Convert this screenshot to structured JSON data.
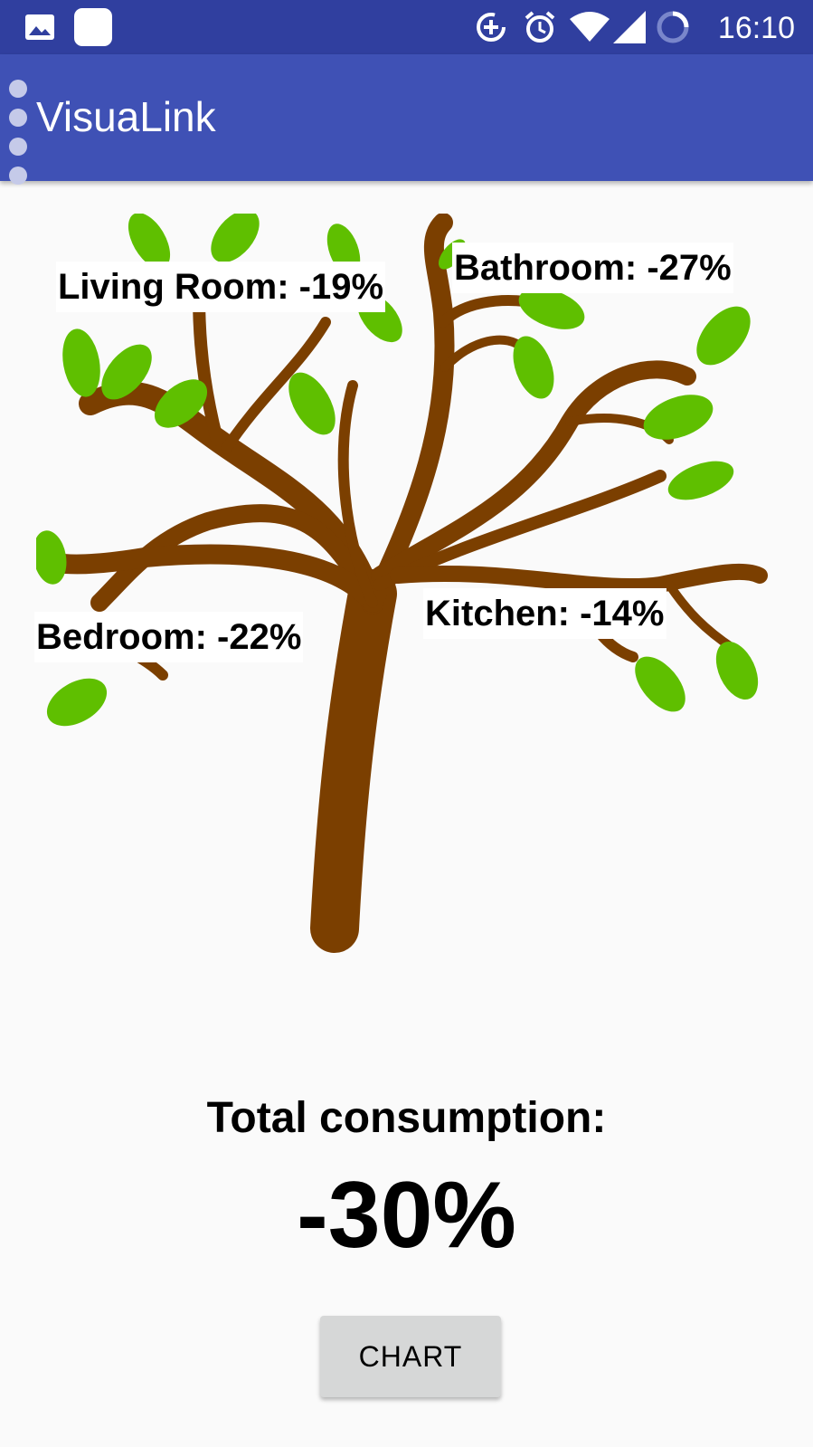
{
  "status_bar": {
    "time": "16:10",
    "left_icons": [
      "image-notification-icon",
      "app-notification-icon"
    ],
    "right_icons": [
      "data-saver-icon",
      "alarm-icon",
      "wifi-icon",
      "cell-signal-icon",
      "battery-icon"
    ]
  },
  "app_bar": {
    "title": "VisuaLink"
  },
  "rooms": [
    {
      "label": "Living Room: -19%"
    },
    {
      "label": "Bathroom: -27%"
    },
    {
      "label": "Bedroom: -22%"
    },
    {
      "label": "Kitchen: -14%"
    }
  ],
  "summary": {
    "title": "Total consumption:",
    "value": "-30%"
  },
  "button": {
    "label": "CHART"
  },
  "colors": {
    "status_bar": "#303f9f",
    "app_bar": "#3f51b5",
    "trunk": "#7b3f00",
    "leaf": "#5fbf00",
    "background": "#fafafa",
    "button": "#d6d7d7"
  }
}
